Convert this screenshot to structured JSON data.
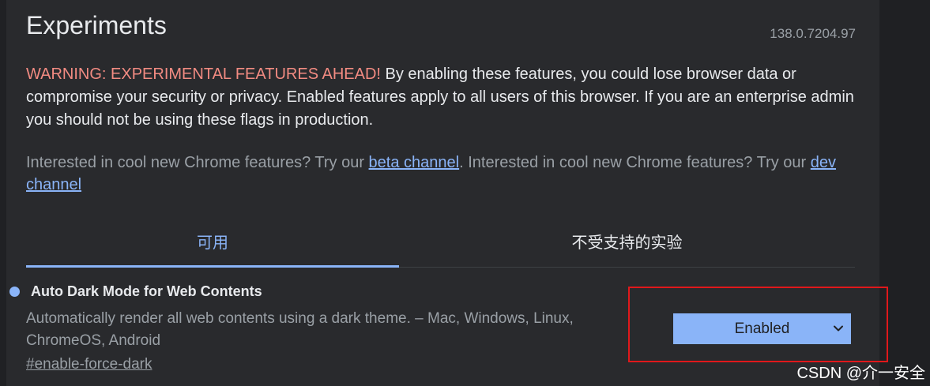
{
  "header": {
    "title": "Experiments",
    "version": "138.0.7204.97"
  },
  "warning": {
    "label": "WARNING: EXPERIMENTAL FEATURES AHEAD!",
    "text": " By enabling these features, you could lose browser data or compromise your security or privacy. Enabled features apply to all users of this browser. If you are an enterprise admin you should not be using these flags in production."
  },
  "promo": {
    "text_1": "Interested in cool new Chrome features? Try our ",
    "link_1": "beta channel",
    "text_2": ". Interested in cool new Chrome features? Try our ",
    "link_2": "dev channel"
  },
  "tabs": [
    {
      "label": "可用",
      "active": true
    },
    {
      "label": "不受支持的实验",
      "active": false
    }
  ],
  "flag": {
    "name": "Auto Dark Mode for Web Contents",
    "description": "Automatically render all web contents using a dark theme. – Mac, Windows, Linux, ChromeOS, Android",
    "link": "#enable-force-dark",
    "selected_value": "Enabled",
    "icon": "chevron-down-icon"
  },
  "watermark": "CSDN @介一安全",
  "colors": {
    "accent": "#8ab4f8",
    "warning": "#f28b82",
    "highlight": "#e0181b"
  }
}
